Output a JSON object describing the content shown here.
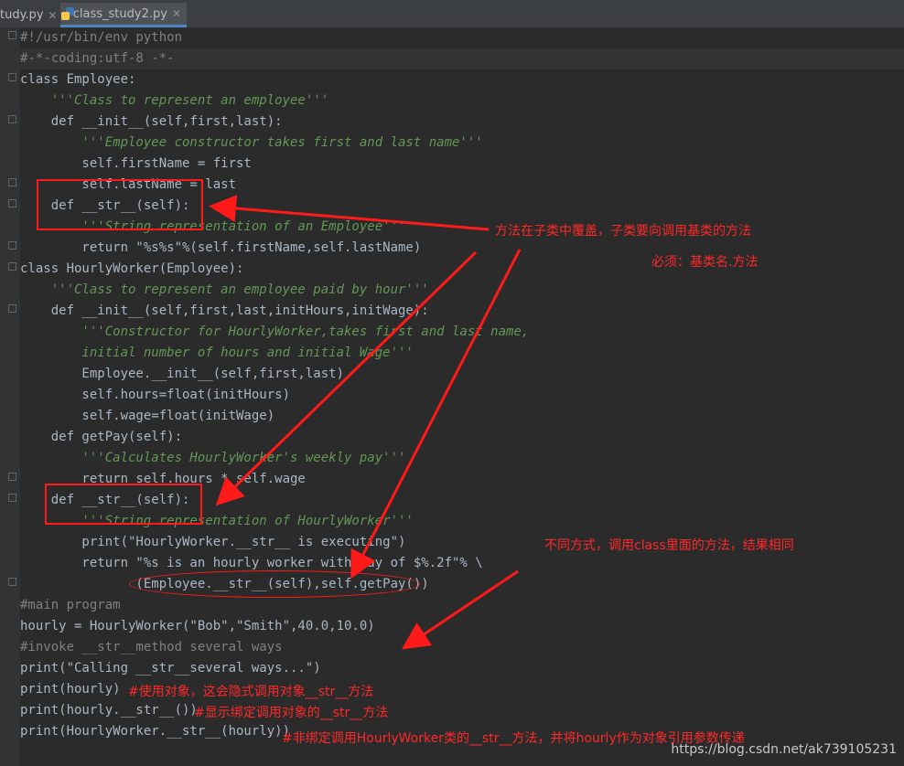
{
  "tabs": [
    {
      "label": "tudy.py",
      "active": false
    },
    {
      "label": "class_study2.py",
      "active": true
    }
  ],
  "code_lines": [
    "#!/usr/bin/env python",
    "#-*-coding:utf-8 -*-",
    "class Employee:",
    "    '''Class to represent an employee'''",
    "    def __init__(self,first,last):",
    "        '''Employee constructor takes first and last name'''",
    "        self.firstName = first",
    "        self.lastName = last",
    "    def __str__(self):",
    "        '''String representation of an Employee'''",
    "        return \"%s%s\"%(self.firstName,self.lastName)",
    "class HourlyWorker(Employee):",
    "    '''Class to represent an employee paid by hour'''",
    "    def __init__(self,first,last,initHours,initWage):",
    "        '''Constructor for HourlyWorker,takes first and last name,",
    "        initial number of hours and initial Wage'''",
    "        Employee.__init__(self,first,last)",
    "        self.hours=float(initHours)",
    "        self.wage=float(initWage)",
    "    def getPay(self):",
    "        '''Calculates HourlyWorker's weekly pay'''",
    "        return self.hours * self.wage",
    "    def __str__(self):",
    "        '''String representation of HourlyWorker'''",
    "        print(\"HourlyWorker.__str__ is executing\")",
    "        return \"%s is an hourly worker with pay of $%.2f\"% \\",
    "               (Employee.__str__(self),self.getPay())",
    "#main program",
    "hourly = HourlyWorker(\"Bob\",\"Smith\",40.0,10.0)",
    "#invoke __str__method several ways",
    "print(\"Calling __str__several ways...\")",
    "print(hourly)",
    "print(hourly.__str__())",
    "print(HourlyWorker.__str__(hourly))"
  ],
  "annotations": {
    "override_note": "方法在子类中覆盖，子类要向调用基类的方法",
    "must_note": "必须：基类名.方法",
    "different_ways_note": "不同方式，调用class里面的方法，结果相同",
    "implicit_call_note": "#使用对象，这会隐式调用对象__str__方法",
    "bound_call_note": "#显示绑定调用对象的__str__方法",
    "unbound_call_note": "#非绑定调用HourlyWorker类的__str__方法，并将hourly作为对象引用参数传递"
  },
  "watermark": "https://blog.csdn.net/ak739105231",
  "colors": {
    "editor_bg": "#2b2b2b",
    "keyword": "#cc7832",
    "self": "#94558d",
    "string": "#6a8759",
    "docstring": "#629755",
    "annotation_red": "#ff2828"
  }
}
